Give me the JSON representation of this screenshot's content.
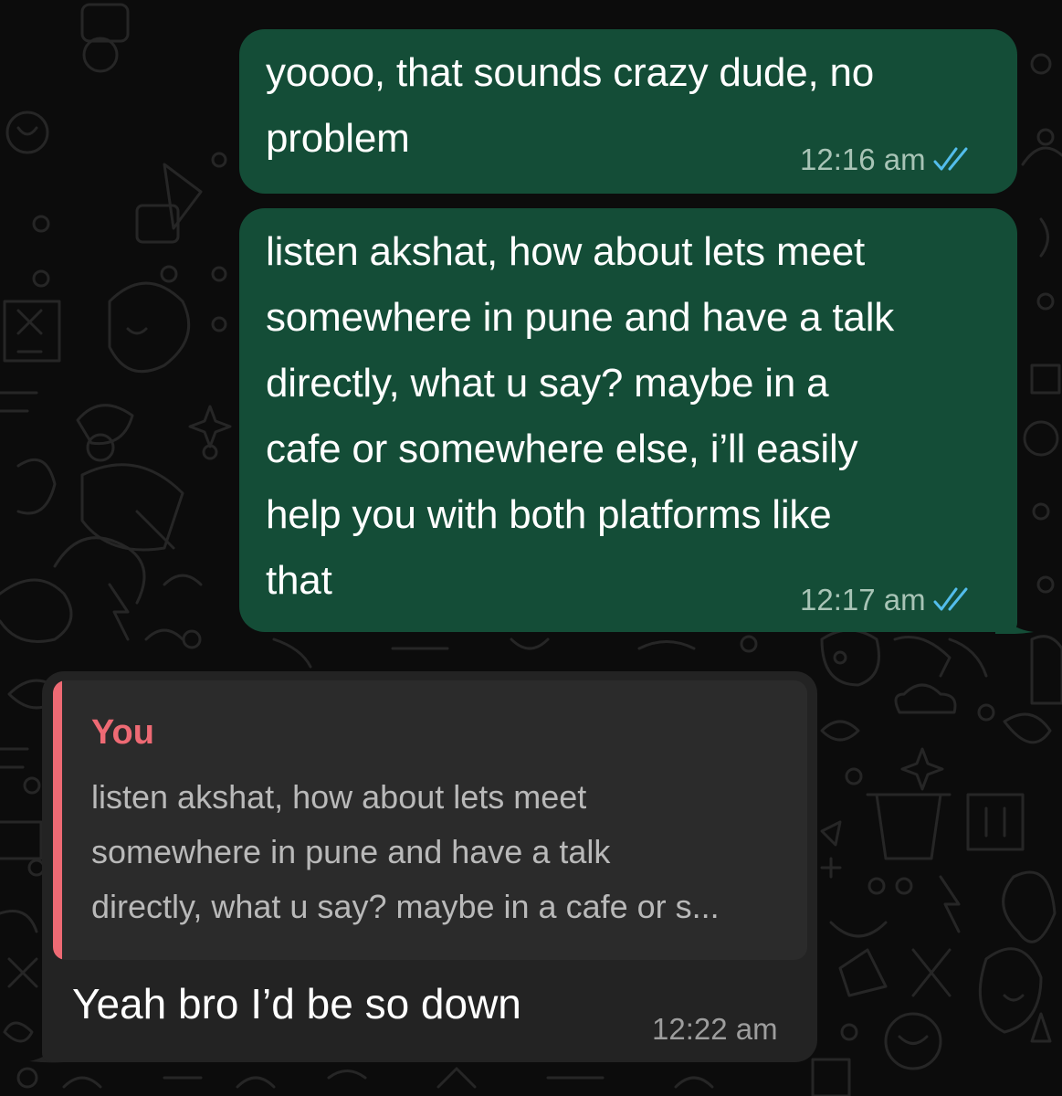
{
  "messages": [
    {
      "direction": "outgoing",
      "lines": [
        "yoooo, that sounds crazy dude, no",
        "problem"
      ],
      "time": "12:16 am",
      "status_icon": "double-check-read-icon"
    },
    {
      "direction": "outgoing",
      "lines": [
        "listen akshat, how about lets meet",
        "somewhere in pune and have a talk",
        "directly, what u say? maybe in a",
        "cafe or somewhere else, i’ll easily",
        "help you with both platforms like",
        "that"
      ],
      "time": "12:17 am",
      "status_icon": "double-check-read-icon"
    },
    {
      "direction": "incoming",
      "reply_to": {
        "author": "You",
        "lines": [
          "listen akshat, how about lets meet",
          "somewhere in pune and have a talk",
          "directly, what u say? maybe in a cafe or s..."
        ]
      },
      "text": "Yeah bro I’d be so down",
      "time": "12:22 am"
    }
  ],
  "colors": {
    "outgoing_bubble": "#144d37",
    "incoming_bubble": "#232323",
    "quote_accent": "#ee6a74",
    "read_tick": "#53bdeb"
  }
}
